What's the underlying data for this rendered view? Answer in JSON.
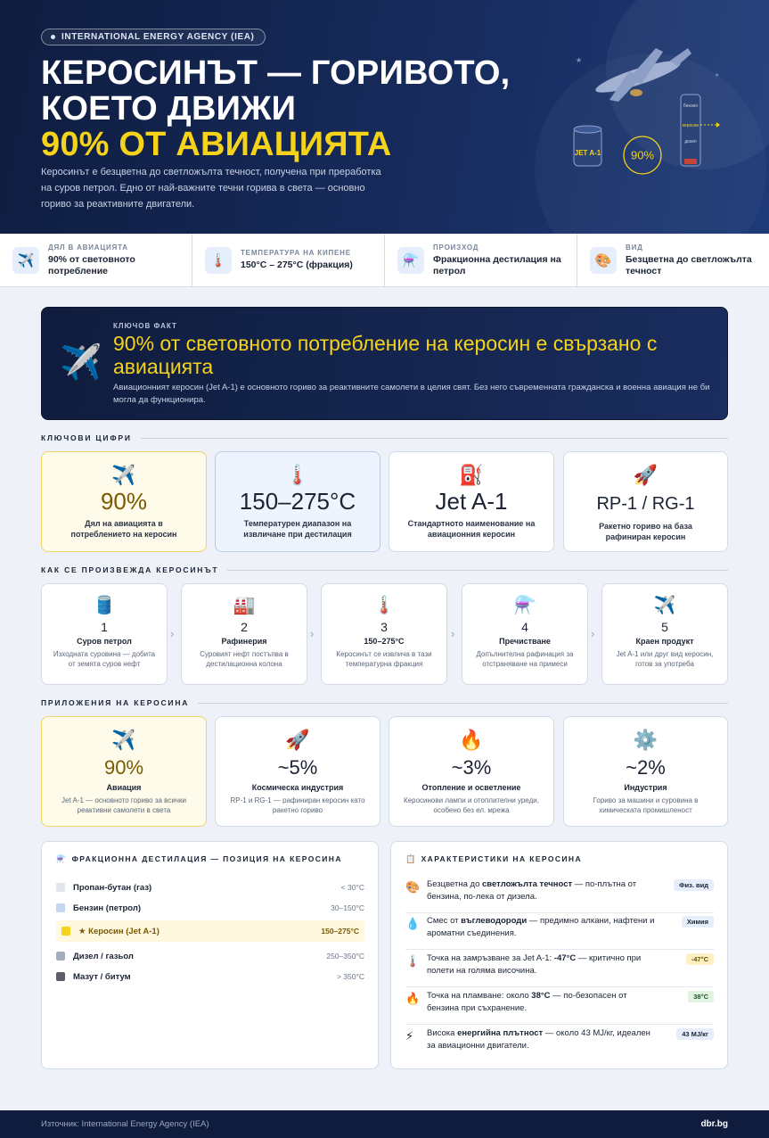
{
  "hero": {
    "badge": "INTERNATIONAL ENERGY AGENCY (IEA)",
    "title_line1": "КЕРОСИНЪТ — ГОРИВОТО,",
    "title_line2": "КОЕТО ДВИЖИ",
    "title_highlight": "90% ОТ АВИАЦИЯТА",
    "subtitle": "Керосинът е безцветна до светложълта течност, получена при преработка на суров петрол. Едно от най-важните течни горива в света — основно гориво за реактивните двигатели.",
    "art": {
      "tank_label": "JET A-1",
      "circle_label": "90%",
      "column_labels": [
        "бензин",
        "керосин",
        "дизел"
      ]
    }
  },
  "stats": [
    {
      "icon": "airplane-icon",
      "glyph": "✈️",
      "label": "ДЯЛ В АВИАЦИЯТА",
      "value": "90% от световното потребление"
    },
    {
      "icon": "thermometer-icon",
      "glyph": "🌡️",
      "label": "ТЕМПЕРАТУРА НА КИПЕНЕ",
      "value": "150°C – 275°C (фракция)"
    },
    {
      "icon": "flask-icon",
      "glyph": "⚗️",
      "label": "ПРОИЗХОД",
      "value": "Фракционна дестилация на петрол"
    },
    {
      "icon": "palette-icon",
      "glyph": "🎨",
      "label": "ВИД",
      "value": "Безцветна до светложълта течност"
    }
  ],
  "keyfact": {
    "label": "КЛЮЧОВ ФАКТ",
    "title": "90% от световното потребление на керосин е свързано с авиацията",
    "text": "Авиационният керосин (Jet A-1) е основното гориво за реактивните самолети в целия свят. Без него съвременната гражданска и военна авиация не би могла да функционира."
  },
  "sections": {
    "figures": "КЛЮЧОВИ ЦИФРИ",
    "process": "КАК СЕ ПРОИЗВЕЖДА КЕРОСИНЪТ",
    "apps": "ПРИЛОЖЕНИЯ НА КЕРОСИНА"
  },
  "figures": [
    {
      "glyph": "✈️",
      "value": "90%",
      "desc": "Дял на авиацията в потреблението на керосин"
    },
    {
      "glyph": "🌡️",
      "value": "150–275°C",
      "desc": "Температурен диапазон на извличане при дестилация"
    },
    {
      "glyph": "⛽",
      "value": "Jet A-1",
      "desc": "Стандартното наименование на авиационния керосин"
    },
    {
      "glyph": "🚀",
      "value": "RP-1 / RG-1",
      "desc": "Ракетно гориво на база рафиниран керосин"
    }
  ],
  "steps": [
    {
      "glyph": "🛢️",
      "num": "1",
      "title": "Суров петрол",
      "text": "Изходната суровина — добита от земята суров нефт"
    },
    {
      "glyph": "🏭",
      "num": "2",
      "title": "Рафинерия",
      "text": "Суровият нефт постъпва в дестилационна колона"
    },
    {
      "glyph": "🌡️",
      "num": "3",
      "title": "150–275°C",
      "text": "Керосинът се извлича в тази температурна фракция"
    },
    {
      "glyph": "⚗️",
      "num": "4",
      "title": "Пречистване",
      "text": "Допълнителна рафинация за отстраняване на примеси"
    },
    {
      "glyph": "✈️",
      "num": "5",
      "title": "Краен продукт",
      "text": "Jet A-1 или друг вид керосин, готов за употреба"
    }
  ],
  "apps": [
    {
      "glyph": "✈️",
      "value": "90%",
      "title": "Авиация",
      "text": "Jet A-1 — основното гориво за всички реактивни самолети в света"
    },
    {
      "glyph": "🚀",
      "value": "~5%",
      "title": "Космическа индустрия",
      "text": "RP-1 и RG-1 — рафиниран керосин като ракетно гориво"
    },
    {
      "glyph": "🔥",
      "value": "~3%",
      "title": "Отопление и осветление",
      "text": "Керосинови лампи и отоплителни уреди, особено без ел. мрежа"
    },
    {
      "glyph": "⚙️",
      "value": "~2%",
      "title": "Индустрия",
      "text": "Гориво за машини и суровина в химическата промишленост"
    }
  ],
  "fractions": {
    "title": "ФРАКЦИОННА ДЕСТИЛАЦИЯ — ПОЗИЦИЯ НА КЕРОСИНА",
    "items": [
      {
        "name": "Пропан-бутан (газ)",
        "temp": "< 30°C",
        "color": "#e3e6eb"
      },
      {
        "name": "Бензин (петрол)",
        "temp": "30–150°C",
        "color": "#c3d8ee"
      },
      {
        "name": "★ Керосин (Jet A-1)",
        "temp": "150–275°C",
        "color": "#f6d31b"
      },
      {
        "name": "Дизел / газьол",
        "temp": "250–350°C",
        "color": "#a6adc0"
      },
      {
        "name": "Мазут / битум",
        "temp": "> 350°C",
        "color": "#5b5d69"
      }
    ]
  },
  "characteristics": {
    "title": "ХАРАКТЕРИСТИКИ НА КЕРОСИНА",
    "items": [
      {
        "glyph": "🎨",
        "pre": "Безцветна до ",
        "bold": "светложълта течност",
        "post": " — по-плътна от бензина, по-лека от дизела.",
        "tag": "Физ. вид"
      },
      {
        "glyph": "💧",
        "pre": "Смес от ",
        "bold": "въглеводороди",
        "post": " — предимно алкани, нафтени и ароматни съединения.",
        "tag": "Химия"
      },
      {
        "glyph": "🌡️",
        "pre": "Точка на замръзване за Jet A-1: ",
        "bold": "-47°C",
        "post": " — критично при полети на голяма височина.",
        "tag": "-47°C"
      },
      {
        "glyph": "🔥",
        "pre": "Точка на пламване: около ",
        "bold": "38°C",
        "post": " — по-безопасен от бензина при съхранение.",
        "tag": "38°C"
      },
      {
        "glyph": "⚡",
        "pre": "Висока ",
        "bold": "енергийна плътност",
        "post": " — около 43 MJ/кг, идеален за авиационни двигатели.",
        "tag": "43 MJ/кг"
      }
    ]
  },
  "footer": {
    "source": "Източник: International Energy Agency (IEA)",
    "brand": "dbr.bg"
  }
}
